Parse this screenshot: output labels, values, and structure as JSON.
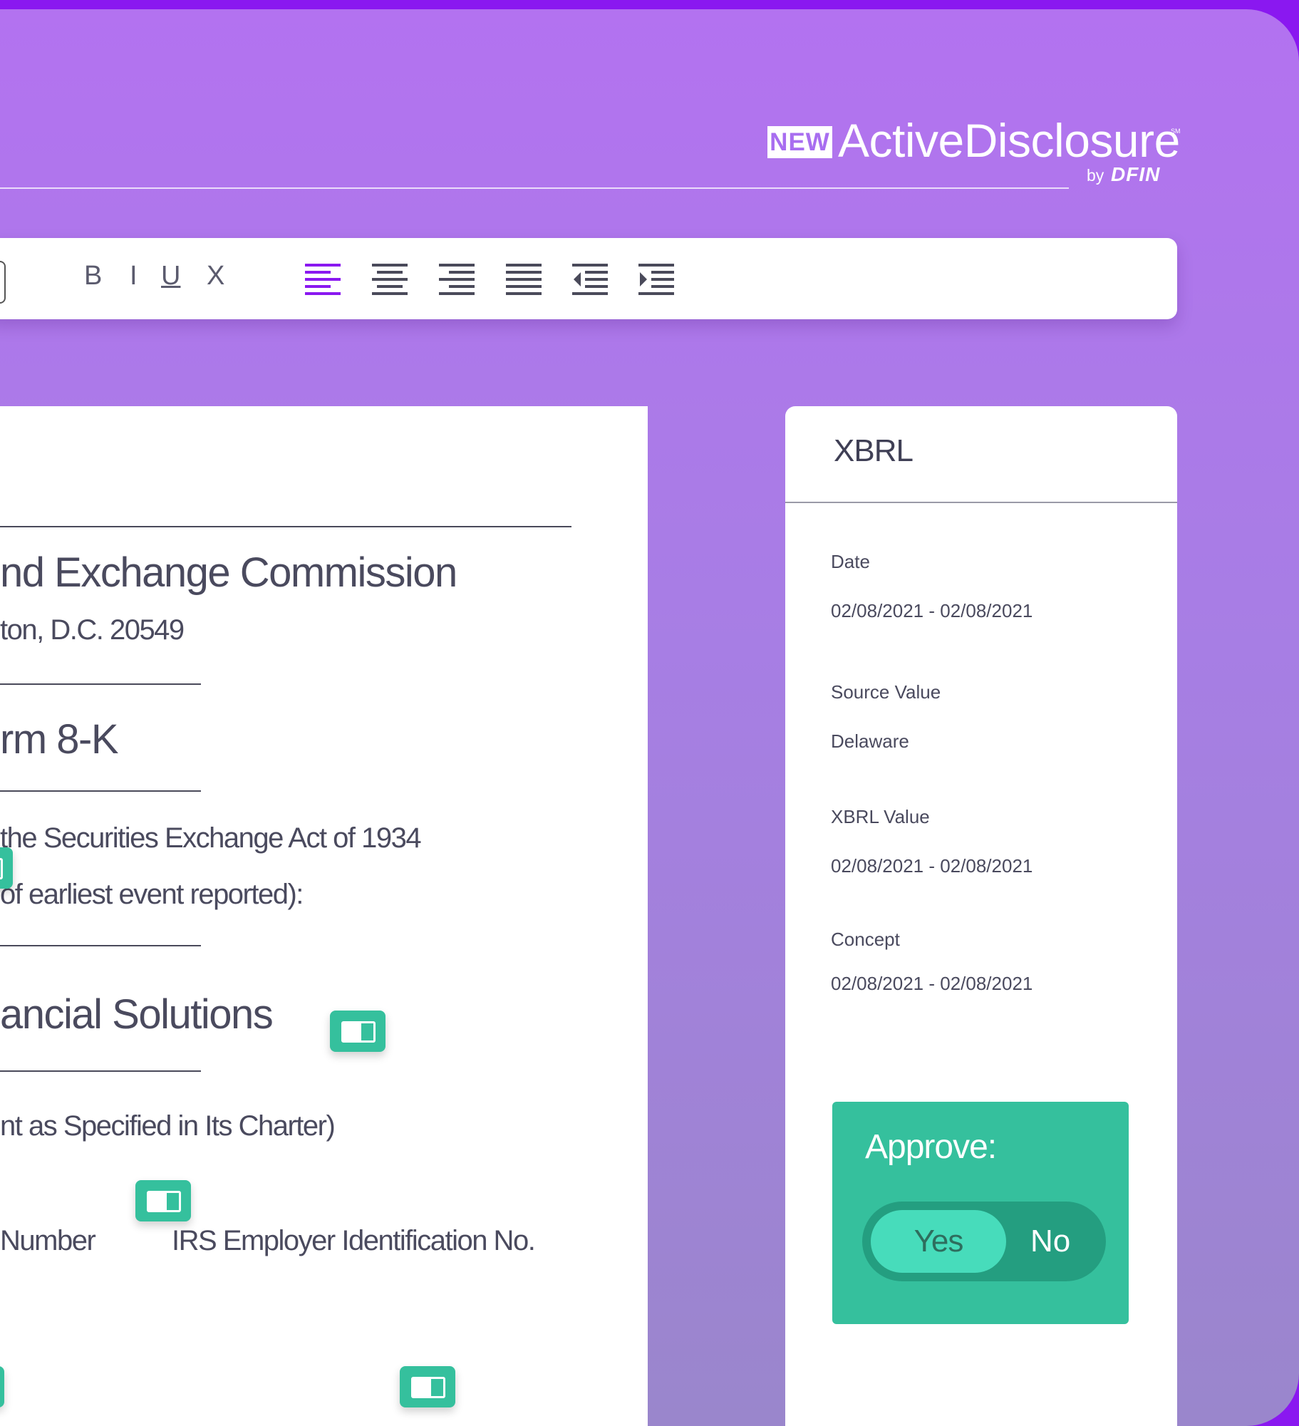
{
  "brand": {
    "badge": "NEW",
    "name": "ActiveDisclosure",
    "sm": "SM",
    "by": "by",
    "company": "DFIN"
  },
  "toolbar": {
    "bold": "B",
    "italic": "I",
    "underline": "U",
    "strike": "X",
    "active_alignment": "align-left"
  },
  "document": {
    "line1": "nd Exchange Commission",
    "line2": "ton, D.C. 20549",
    "line3": "rm 8-K",
    "line4": "the Securities Exchange Act of 1934",
    "line5": "of earliest event reported):",
    "line6": "ancial Solutions",
    "line7": "nt as Specified in Its Charter)",
    "line8a": "Number",
    "line8b": "IRS Employer Identification No."
  },
  "xbrl": {
    "title": "XBRL",
    "fields": [
      {
        "label": "Date",
        "value": "02/08/2021 - 02/08/2021"
      },
      {
        "label": "Source Value",
        "value": "Delaware"
      },
      {
        "label": "XBRL Value",
        "value": "02/08/2021 - 02/08/2021"
      },
      {
        "label": "Concept",
        "value": "02/08/2021 - 02/08/2021"
      }
    ],
    "approve": {
      "label": "Approve:",
      "yes": "Yes",
      "no": "No",
      "selected": "Yes"
    }
  },
  "colors": {
    "accent_purple": "#8a18f0",
    "teal": "#35c09d",
    "text": "#4a4a5e"
  }
}
